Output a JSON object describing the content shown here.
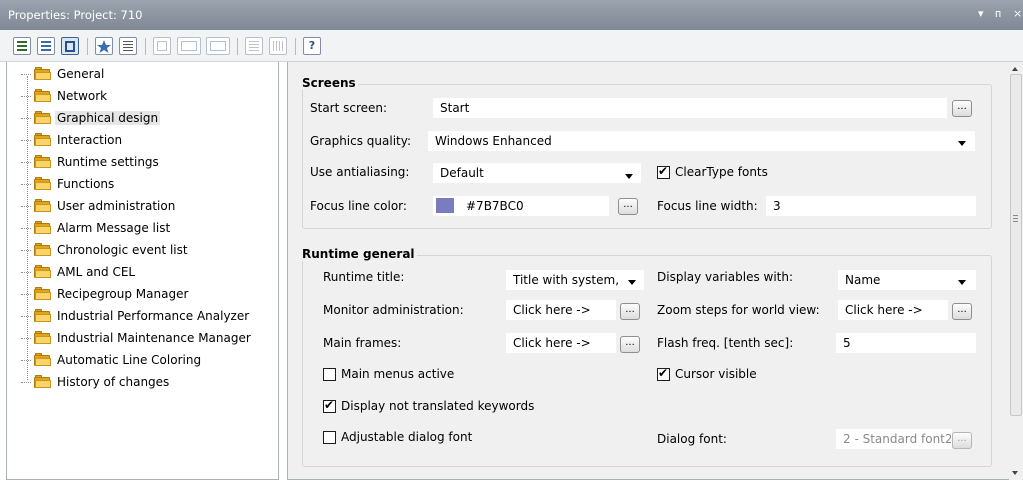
{
  "window": {
    "title": "Properties: Project: 710",
    "controls": {
      "dropdown": "▾",
      "pin": "ᴨ",
      "close": "×"
    }
  },
  "toolbar": {
    "buttons": [
      {
        "icon": "categorized-view-icon",
        "active": false
      },
      {
        "icon": "alphabetical-view-icon",
        "active": false
      },
      {
        "icon": "grouped-view-icon",
        "active": true
      },
      {
        "icon": "favorites-icon",
        "active": false
      },
      {
        "icon": "property-pages-icon",
        "active": false
      },
      {
        "icon": "simple-view-icon",
        "active": false
      },
      {
        "icon": "expanded-view-icon",
        "active": false
      },
      {
        "icon": "collapsed-view-icon",
        "active": false
      },
      {
        "icon": "expand-all-icon",
        "active": false
      },
      {
        "icon": "collapse-all-icon",
        "active": false
      },
      {
        "icon": "help-icon",
        "active": false
      }
    ],
    "help_label": "?"
  },
  "tree": {
    "items": [
      {
        "label": "General",
        "selected": false
      },
      {
        "label": "Network",
        "selected": false
      },
      {
        "label": "Graphical design",
        "selected": true
      },
      {
        "label": "Interaction",
        "selected": false
      },
      {
        "label": "Runtime settings",
        "selected": false
      },
      {
        "label": "Functions",
        "selected": false
      },
      {
        "label": "User administration",
        "selected": false
      },
      {
        "label": "Alarm Message list",
        "selected": false
      },
      {
        "label": "Chronologic event list",
        "selected": false
      },
      {
        "label": "AML and CEL",
        "selected": false
      },
      {
        "label": "Recipegroup Manager",
        "selected": false
      },
      {
        "label": "Industrial Performance Analyzer",
        "selected": false
      },
      {
        "label": "Industrial Maintenance Manager",
        "selected": false
      },
      {
        "label": "Automatic Line Coloring",
        "selected": false
      },
      {
        "label": "History of changes",
        "selected": false
      }
    ]
  },
  "screens": {
    "title": "Screens",
    "start_screen_label": "Start screen:",
    "start_screen_value": "Start",
    "graphics_quality_label": "Graphics quality:",
    "graphics_quality_value": "Windows Enhanced",
    "antialiasing_label": "Use antialiasing:",
    "antialiasing_value": "Default",
    "cleartype_label": "ClearType fonts",
    "cleartype_checked": true,
    "focus_color_label": "Focus line color:",
    "focus_color_value": "#7B7BC0",
    "focus_color_swatch": "#7b7bc0",
    "focus_width_label": "Focus line width:",
    "focus_width_value": "3"
  },
  "runtime": {
    "title": "Runtime general",
    "runtime_title_label": "Runtime title:",
    "runtime_title_value": "Title with system,",
    "display_vars_label": "Display variables with:",
    "display_vars_value": "Name",
    "monitor_admin_label": "Monitor administration:",
    "monitor_admin_value": "Click here ->",
    "zoom_steps_label": "Zoom steps for world view:",
    "zoom_steps_value": "Click here ->",
    "main_frames_label": "Main frames:",
    "main_frames_value": "Click here ->",
    "flash_freq_label": "Flash freq. [tenth sec]:",
    "flash_freq_value": "5",
    "main_menus_label": "Main menus active",
    "main_menus_checked": false,
    "cursor_visible_label": "Cursor visible",
    "cursor_visible_checked": true,
    "display_keywords_label": "Display not translated keywords",
    "display_keywords_checked": true,
    "adjustable_font_label": "Adjustable dialog font",
    "adjustable_font_checked": false,
    "dialog_font_label": "Dialog font:",
    "dialog_font_value": "2 - Standard font2"
  },
  "ellipsis": "...",
  "check_mark": "✔"
}
